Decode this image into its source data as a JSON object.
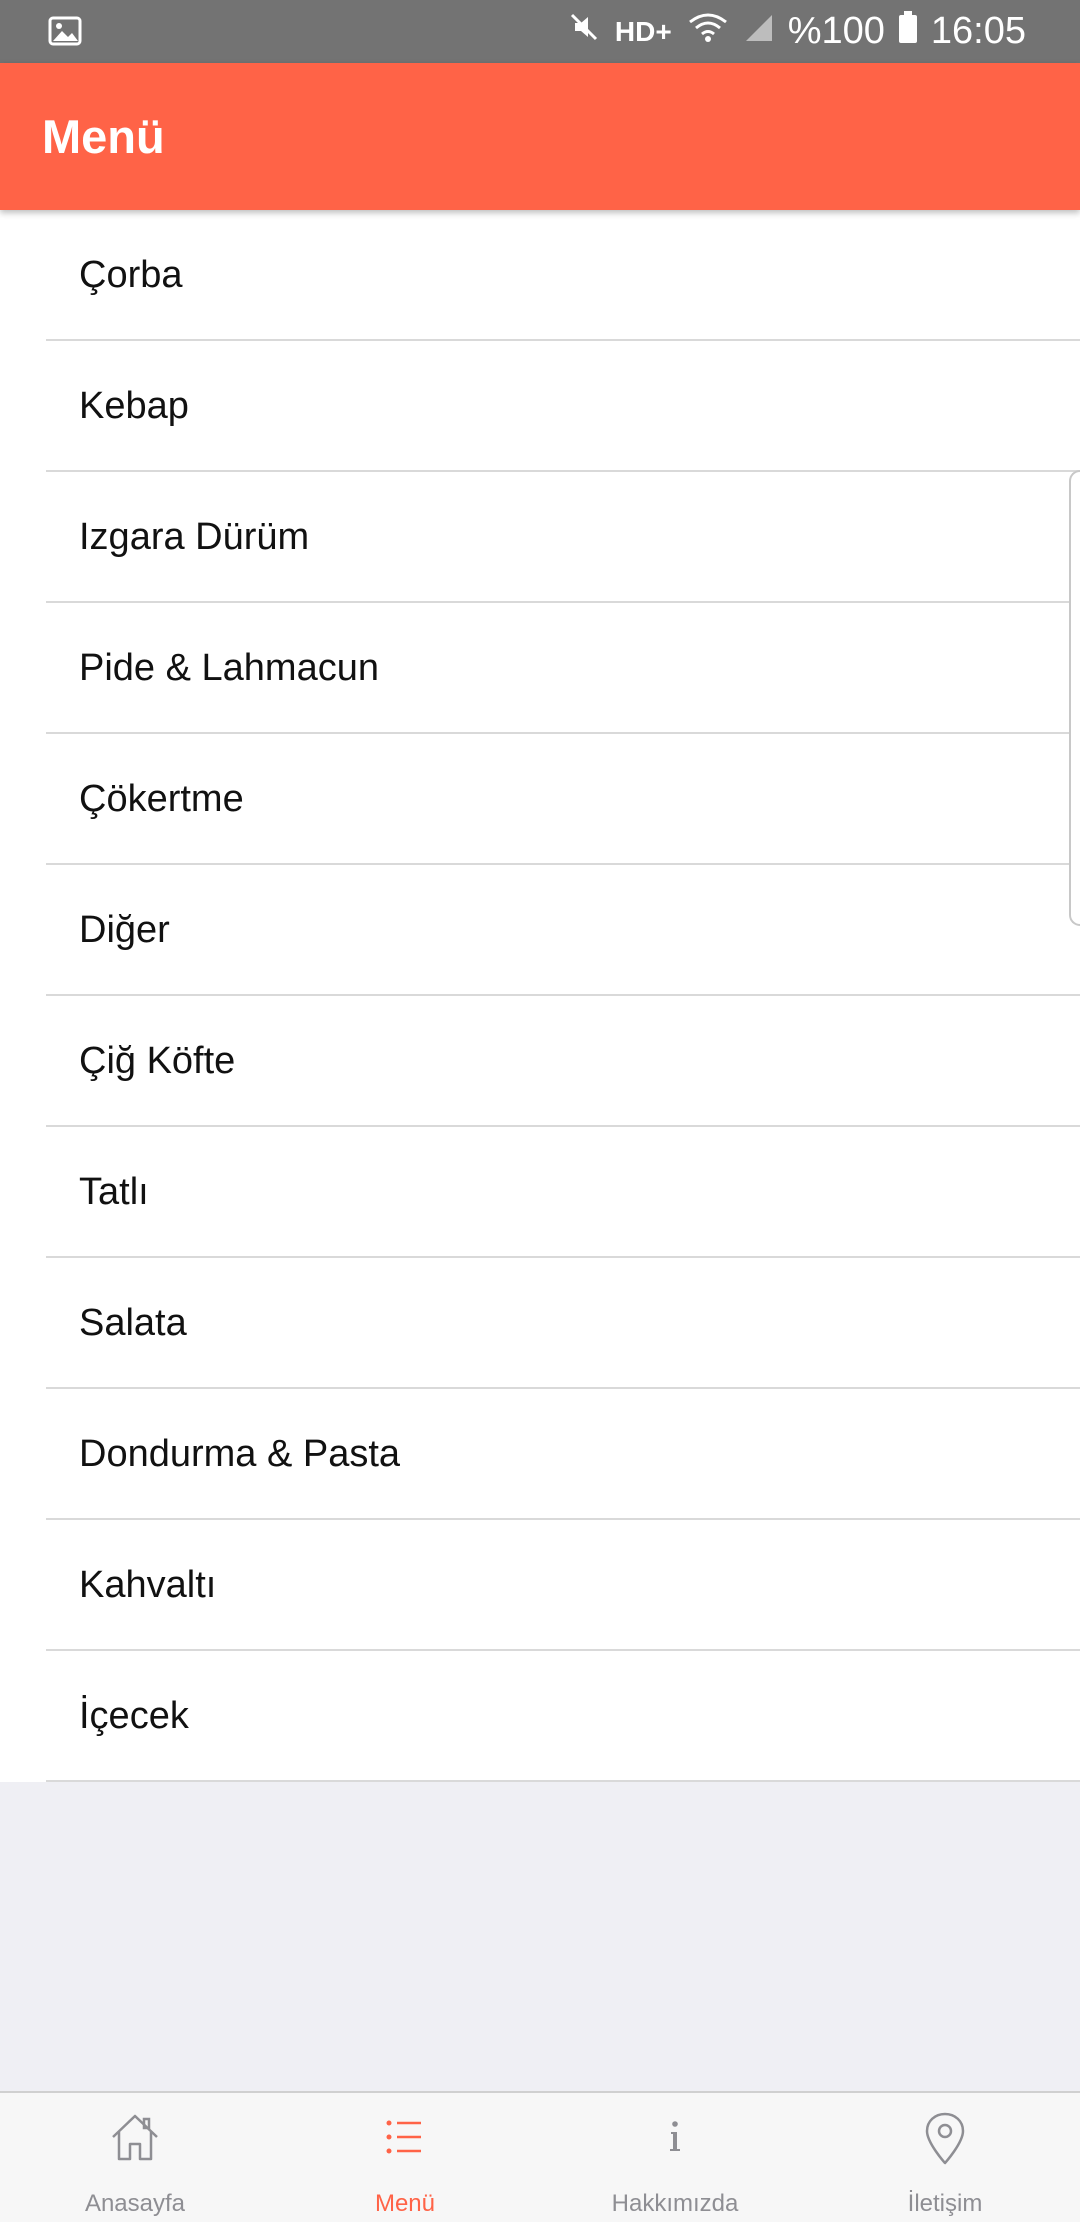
{
  "status_bar": {
    "left_icon": "image-icon",
    "hd_label": "HD+",
    "battery": "%100",
    "time": "16:05"
  },
  "app_bar": {
    "title": "Menü",
    "color": "#ff6347"
  },
  "menu": {
    "items": [
      {
        "label": "Çorba"
      },
      {
        "label": "Kebap"
      },
      {
        "label": "Izgara Dürüm"
      },
      {
        "label": "Pide & Lahmacun"
      },
      {
        "label": "Çökertme"
      },
      {
        "label": "Diğer"
      },
      {
        "label": "Çiğ Köfte"
      },
      {
        "label": "Tatlı"
      },
      {
        "label": "Salata"
      },
      {
        "label": "Dondurma  & Pasta"
      },
      {
        "label": "Kahvaltı"
      },
      {
        "label": "İçecek"
      }
    ]
  },
  "tab_bar": {
    "active_color": "#ff6347",
    "inactive_color": "#8e8e93",
    "tabs": [
      {
        "label": "Anasayfa",
        "icon": "home-icon"
      },
      {
        "label": "Menü",
        "icon": "list-icon",
        "active": true
      },
      {
        "label": "Hakkımızda",
        "icon": "info-icon"
      },
      {
        "label": "İletişim",
        "icon": "location-pin-icon"
      }
    ]
  }
}
